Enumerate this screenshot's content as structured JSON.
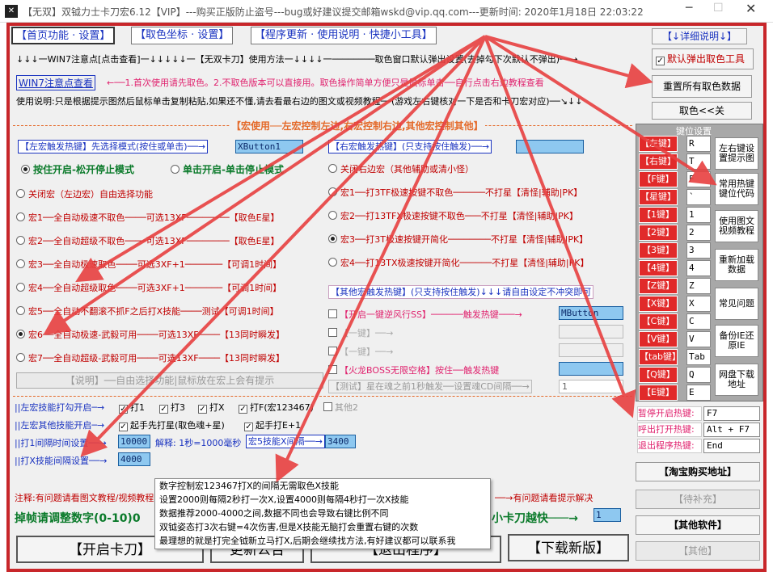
{
  "title": "【无双】双钺力士卡刀宏6.12【VIP】---购买正版防止盗号---bug或好建议提交邮箱wskd@vip.qq.com---更新时间: 2020年1月18日 22:03:22",
  "tabs": [
    "【首页功能 · 设置】",
    "【取色坐标 · 设置】",
    "【程序更新 · 使用说明 · 快捷小工具】"
  ],
  "detail_btn": "【↓详细说明↓】",
  "default_popup": "默认弹出取色工具",
  "reset_btn": "重置所有取色数据",
  "color_close": "取色<<关",
  "line1": "↓↓↓一WIN7注意点[点击查看]一↓↓↓↓↓一【无双卡刀】使用方法一↓↓↓↓一────────取色窗口默认弹出设置(去掉勾下次默认不弹出)──→",
  "win7_link": "WIN7注意点查看",
  "line2": "←──1.首次使用请先取色。2.不取色版本可以直接用。取色操作简单方便只是鼠标单击──自行点击右边教程查看",
  "line3": "使用说明:只是根据提示图然后鼠标单击复制粘贴,如果还不懂,请去看最右边的图文或视频教程──(游戏左右键核对一下是否和卡刀宏对应)──↘↓↓",
  "macro_title": "【宏使用──左宏控制左边,右宏控制右边,其他宏控制其他】",
  "left": {
    "hotkey_label": "【左宏触发热键】先选择模式(按住或单击)──→",
    "hotkey_value": "XButton1",
    "mode1": "按住开启-松开停止模式",
    "mode2": "单击开启-单击停止模式",
    "options": [
      "关闭宏（左边宏）自由选择功能",
      "宏1──全自动极速不取色────可选13XF────────【取色E星】",
      "宏2──全自动超级不取色────可选13XF────────【取色E星】",
      "宏3──全自动极速取色────可选3XF+1───────【可调1时间】",
      "宏4──全自动超级取色────可选3XF+1───────【可调1时间】",
      "宏5──全自动不翻滚不抓F之后打X技能────测试【可调1时间】",
      "宏6──全自动极速-武毅可用────可选13XF────【13同时瞬发】",
      "宏7──全自动超级-武毅可用────可选13XF────【13同时瞬发】"
    ],
    "selected": 6,
    "note_btn": "【说明】──自由选择功能|鼠标放在宏上会有提示"
  },
  "right": {
    "hotkey_label": "【右宏触发热键】(只支持按住触发)──→",
    "hotkey_value": "",
    "options": [
      "关闭右边宏（其他辅助或清小怪）",
      "宏1──打3TF极速按键不取色──────不打星【清怪|辅助|PK】",
      "宏2──打13TFX极速按键不取色───不打星【清怪|辅助|PK】",
      "宏3──打3T极速按键开简化────────不打星【清怪|辅助|PK】",
      "宏4──打13TX极速按键开简化──────不打星【清怪|辅助|PK】"
    ],
    "selected": 3
  },
  "other": {
    "title": "【其他宏触发热键】(只支持按住触发)↓↓↓请自由设定不冲突即可",
    "rows": [
      {
        "label": "【开启一键逆风行SS】──────触发热键───→",
        "value": "MButton"
      },
      {
        "label": "【一键】──→",
        "value": ""
      },
      {
        "label": "【一键】──→",
        "value": ""
      },
      {
        "label": "【火龙BOSS无限空格】按住──触发热键",
        "value": ""
      }
    ],
    "test_label": "【测试】星在魂之前1秒触发──设置魂CD间隔──→",
    "test_value": "1"
  },
  "skill": {
    "row1_label": "||左宏技能打勾开启─→",
    "row1_checks": [
      "打1",
      "打3",
      "打X",
      "打F(宏123467)",
      "其他2"
    ],
    "row2_label": "||左宏其他技能开启─→",
    "row2_checks": [
      "起手先打星(取色魂+星)",
      "起手打E+1"
    ],
    "row3_label": "||打1间隔时间设置──→",
    "row3_value": "10000",
    "row3_explain": "解释: 1秒=1000毫秒",
    "row3_label2": "宏5技能X间隔──→",
    "row3_value2": "3400",
    "row4_label": "||打X技能间隔设置──→",
    "row4_value": "4000"
  },
  "note_line": "注释:有问题请看图文教程/视频教程",
  "note_right": "──→有问题请看提示解决",
  "frame_line": "掉帧请调整数字(0-10)0",
  "frame_right": "小卡刀越快───→",
  "frame_value": "1",
  "bottom_buttons": [
    "【开启卡刀】",
    "更新公告",
    "【退出程序】",
    "【下载新版】"
  ],
  "tooltip": [
    "数字控制宏123467打X的间隔无需取色X技能",
    "设置2000则每隔2秒打一次X,设置4000则每隔4秒打一次X技能",
    "数据推荐2000-4000之间,数据不同也会导致右键比例不同",
    "双钺姿态打3次右键=4次伤害,但是X技能无脑打会重置右键的次数",
    "最理想的就是打完全钺新立马打X,后期会继续找方法,有好建议都可以联系我"
  ],
  "keypanel": {
    "title": "键位设置",
    "keys": [
      {
        "label": "【左键】",
        "value": "R"
      },
      {
        "label": "【右键】",
        "value": "T"
      },
      {
        "label": "【F键】",
        "value": "F"
      },
      {
        "label": "【星键】",
        "value": "`"
      },
      {
        "label": "【1键】",
        "value": "1"
      },
      {
        "label": "【2键】",
        "value": "2"
      },
      {
        "label": "【3键】",
        "value": "3"
      },
      {
        "label": "【4键】",
        "value": "4"
      },
      {
        "label": "【Z键】",
        "value": "Z"
      },
      {
        "label": "【X键】",
        "value": "X"
      },
      {
        "label": "【C键】",
        "value": "C"
      },
      {
        "label": "【V键】",
        "value": "V"
      },
      {
        "label": "【tab键】",
        "value": "Tab"
      },
      {
        "label": "【Q键】",
        "value": "Q"
      },
      {
        "label": "【E键】",
        "value": "E"
      }
    ],
    "side_buttons": [
      "左右键设置提示图",
      "常用热键键位代码",
      "使用图文视频教程",
      "重新加载数据",
      "常见问题",
      "备份IE还原IE",
      "网盘下载地址"
    ]
  },
  "hotkeys": [
    {
      "label": "暂停开启热键:",
      "value": "F7"
    },
    {
      "label": "呼出打开热键:",
      "value": "Alt + F7"
    },
    {
      "label": "退出程序热键:",
      "value": "End"
    }
  ],
  "right_buttons": [
    "【淘宝购买地址】",
    "【待补充】",
    "【其他软件】",
    "【其他】"
  ]
}
